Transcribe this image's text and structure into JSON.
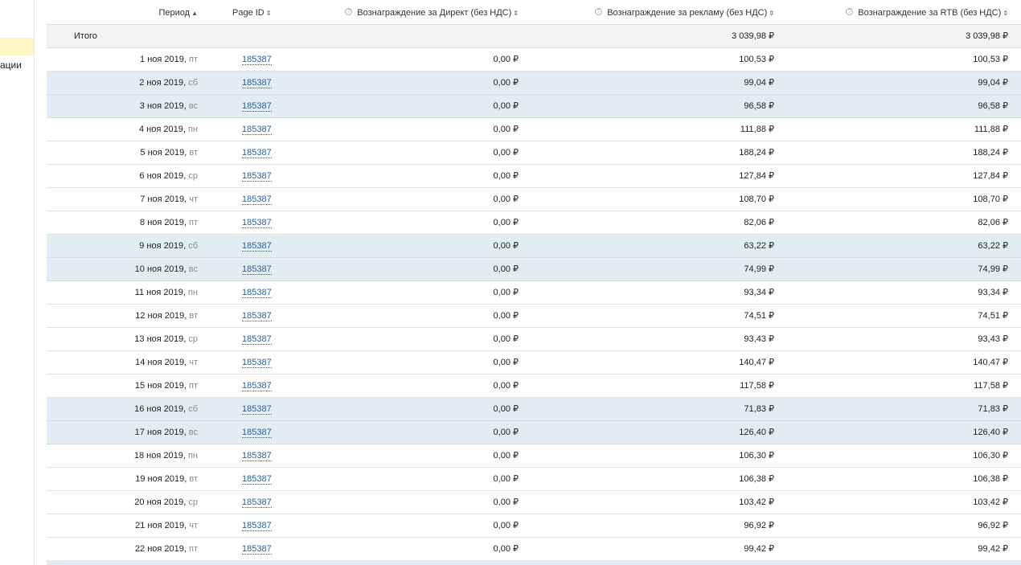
{
  "sidebar": {
    "partial_text": "ации"
  },
  "table": {
    "headers": {
      "period": "Период",
      "page_id": "Page ID",
      "direct": "Вознаграждение за Директ (без НДС)",
      "ads": "Вознаграждение за рекламу (без НДС)",
      "rtb": "Вознаграждение за RTB (без НДС)"
    },
    "total": {
      "label": "Итого",
      "direct": "",
      "ads": "3 039,98 ₽",
      "rtb": "3 039,98 ₽"
    },
    "rows": [
      {
        "date": "1 ноя 2019,",
        "dow": "пт",
        "page_id": "185387",
        "direct": "0,00 ₽",
        "ads": "100,53 ₽",
        "rtb": "100,53 ₽",
        "weekend": false
      },
      {
        "date": "2 ноя 2019,",
        "dow": "сб",
        "page_id": "185387",
        "direct": "0,00 ₽",
        "ads": "99,04 ₽",
        "rtb": "99,04 ₽",
        "weekend": true
      },
      {
        "date": "3 ноя 2019,",
        "dow": "вс",
        "page_id": "185387",
        "direct": "0,00 ₽",
        "ads": "96,58 ₽",
        "rtb": "96,58 ₽",
        "weekend": true
      },
      {
        "date": "4 ноя 2019,",
        "dow": "пн",
        "page_id": "185387",
        "direct": "0,00 ₽",
        "ads": "111,88 ₽",
        "rtb": "111,88 ₽",
        "weekend": false
      },
      {
        "date": "5 ноя 2019,",
        "dow": "вт",
        "page_id": "185387",
        "direct": "0,00 ₽",
        "ads": "188,24 ₽",
        "rtb": "188,24 ₽",
        "weekend": false
      },
      {
        "date": "6 ноя 2019,",
        "dow": "ср",
        "page_id": "185387",
        "direct": "0,00 ₽",
        "ads": "127,84 ₽",
        "rtb": "127,84 ₽",
        "weekend": false
      },
      {
        "date": "7 ноя 2019,",
        "dow": "чт",
        "page_id": "185387",
        "direct": "0,00 ₽",
        "ads": "108,70 ₽",
        "rtb": "108,70 ₽",
        "weekend": false
      },
      {
        "date": "8 ноя 2019,",
        "dow": "пт",
        "page_id": "185387",
        "direct": "0,00 ₽",
        "ads": "82,06 ₽",
        "rtb": "82,06 ₽",
        "weekend": false
      },
      {
        "date": "9 ноя 2019,",
        "dow": "сб",
        "page_id": "185387",
        "direct": "0,00 ₽",
        "ads": "63,22 ₽",
        "rtb": "63,22 ₽",
        "weekend": true
      },
      {
        "date": "10 ноя 2019,",
        "dow": "вс",
        "page_id": "185387",
        "direct": "0,00 ₽",
        "ads": "74,99 ₽",
        "rtb": "74,99 ₽",
        "weekend": true
      },
      {
        "date": "11 ноя 2019,",
        "dow": "пн",
        "page_id": "185387",
        "direct": "0,00 ₽",
        "ads": "93,34 ₽",
        "rtb": "93,34 ₽",
        "weekend": false
      },
      {
        "date": "12 ноя 2019,",
        "dow": "вт",
        "page_id": "185387",
        "direct": "0,00 ₽",
        "ads": "74,51 ₽",
        "rtb": "74,51 ₽",
        "weekend": false
      },
      {
        "date": "13 ноя 2019,",
        "dow": "ср",
        "page_id": "185387",
        "direct": "0,00 ₽",
        "ads": "93,43 ₽",
        "rtb": "93,43 ₽",
        "weekend": false
      },
      {
        "date": "14 ноя 2019,",
        "dow": "чт",
        "page_id": "185387",
        "direct": "0,00 ₽",
        "ads": "140,47 ₽",
        "rtb": "140,47 ₽",
        "weekend": false
      },
      {
        "date": "15 ноя 2019,",
        "dow": "пт",
        "page_id": "185387",
        "direct": "0,00 ₽",
        "ads": "117,58 ₽",
        "rtb": "117,58 ₽",
        "weekend": false
      },
      {
        "date": "16 ноя 2019,",
        "dow": "сб",
        "page_id": "185387",
        "direct": "0,00 ₽",
        "ads": "71,83 ₽",
        "rtb": "71,83 ₽",
        "weekend": true
      },
      {
        "date": "17 ноя 2019,",
        "dow": "вс",
        "page_id": "185387",
        "direct": "0,00 ₽",
        "ads": "126,40 ₽",
        "rtb": "126,40 ₽",
        "weekend": true
      },
      {
        "date": "18 ноя 2019,",
        "dow": "пн",
        "page_id": "185387",
        "direct": "0,00 ₽",
        "ads": "106,30 ₽",
        "rtb": "106,30 ₽",
        "weekend": false
      },
      {
        "date": "19 ноя 2019,",
        "dow": "вт",
        "page_id": "185387",
        "direct": "0,00 ₽",
        "ads": "106,38 ₽",
        "rtb": "106,38 ₽",
        "weekend": false
      },
      {
        "date": "20 ноя 2019,",
        "dow": "ср",
        "page_id": "185387",
        "direct": "0,00 ₽",
        "ads": "103,42 ₽",
        "rtb": "103,42 ₽",
        "weekend": false
      },
      {
        "date": "21 ноя 2019,",
        "dow": "чт",
        "page_id": "185387",
        "direct": "0,00 ₽",
        "ads": "96,92 ₽",
        "rtb": "96,92 ₽",
        "weekend": false
      },
      {
        "date": "22 ноя 2019,",
        "dow": "пт",
        "page_id": "185387",
        "direct": "0,00 ₽",
        "ads": "99,42 ₽",
        "rtb": "99,42 ₽",
        "weekend": false
      }
    ]
  },
  "colors": {
    "weekend_row": "#e2edf1",
    "total_row": "#f2f2f2",
    "link": "#2d5f8f",
    "sidebar_highlight": "#fff6c8"
  }
}
